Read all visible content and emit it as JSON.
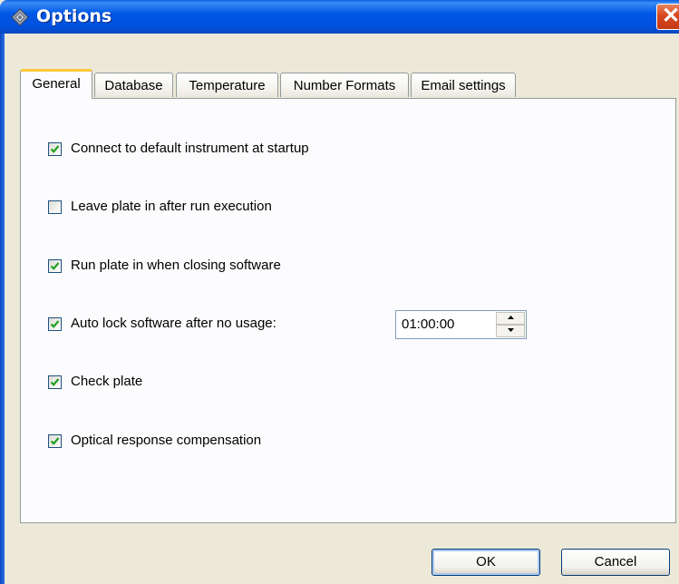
{
  "window": {
    "title": "Options",
    "close_icon": "close-icon",
    "app_icon": "options-gear-icon",
    "title_bar_color": "#0058e6"
  },
  "tabs": [
    {
      "label": "General",
      "active": true
    },
    {
      "label": "Database",
      "active": false
    },
    {
      "label": "Temperature",
      "active": false
    },
    {
      "label": "Number Formats",
      "active": false
    },
    {
      "label": "Email settings",
      "active": false
    }
  ],
  "options": [
    {
      "label": "Connect to default instrument at startup",
      "checked": true
    },
    {
      "label": "Leave plate in after run execution",
      "checked": false
    },
    {
      "label": "Run plate in when closing software",
      "checked": true
    },
    {
      "label": "Auto lock software after no usage:",
      "checked": true
    },
    {
      "label": "Check plate",
      "checked": true
    },
    {
      "label": "Optical response compensation",
      "checked": true
    }
  ],
  "auto_lock": {
    "value": "01:00:00"
  },
  "buttons": {
    "ok": "OK",
    "cancel": "Cancel"
  }
}
